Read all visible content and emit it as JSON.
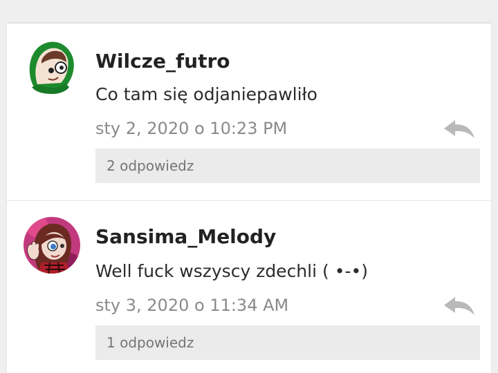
{
  "colors": {
    "background": "#efefef",
    "card": "#ffffff",
    "reply_box": "#ebebeb",
    "muted_text": "#8a8a8a",
    "reply_icon": "#b9b9b9"
  },
  "comments": [
    {
      "username": "Wilcze_futro",
      "message": "Co tam się odjaniepawliło",
      "timestamp": "sty 2, 2020 o 10:23 PM",
      "replies_label": "2 odpowiedz",
      "avatar_icon": "green-hood-avatar-icon",
      "reply_icon": "reply-arrow-icon"
    },
    {
      "username": "Sansima_Melody",
      "message": "Well fuck wszyscy zdechli ( •-•)",
      "timestamp": "sty 3, 2020 o 11:34 AM",
      "replies_label": "1 odpowiedz",
      "avatar_icon": "waving-girl-avatar-icon",
      "reply_icon": "reply-arrow-icon"
    }
  ]
}
